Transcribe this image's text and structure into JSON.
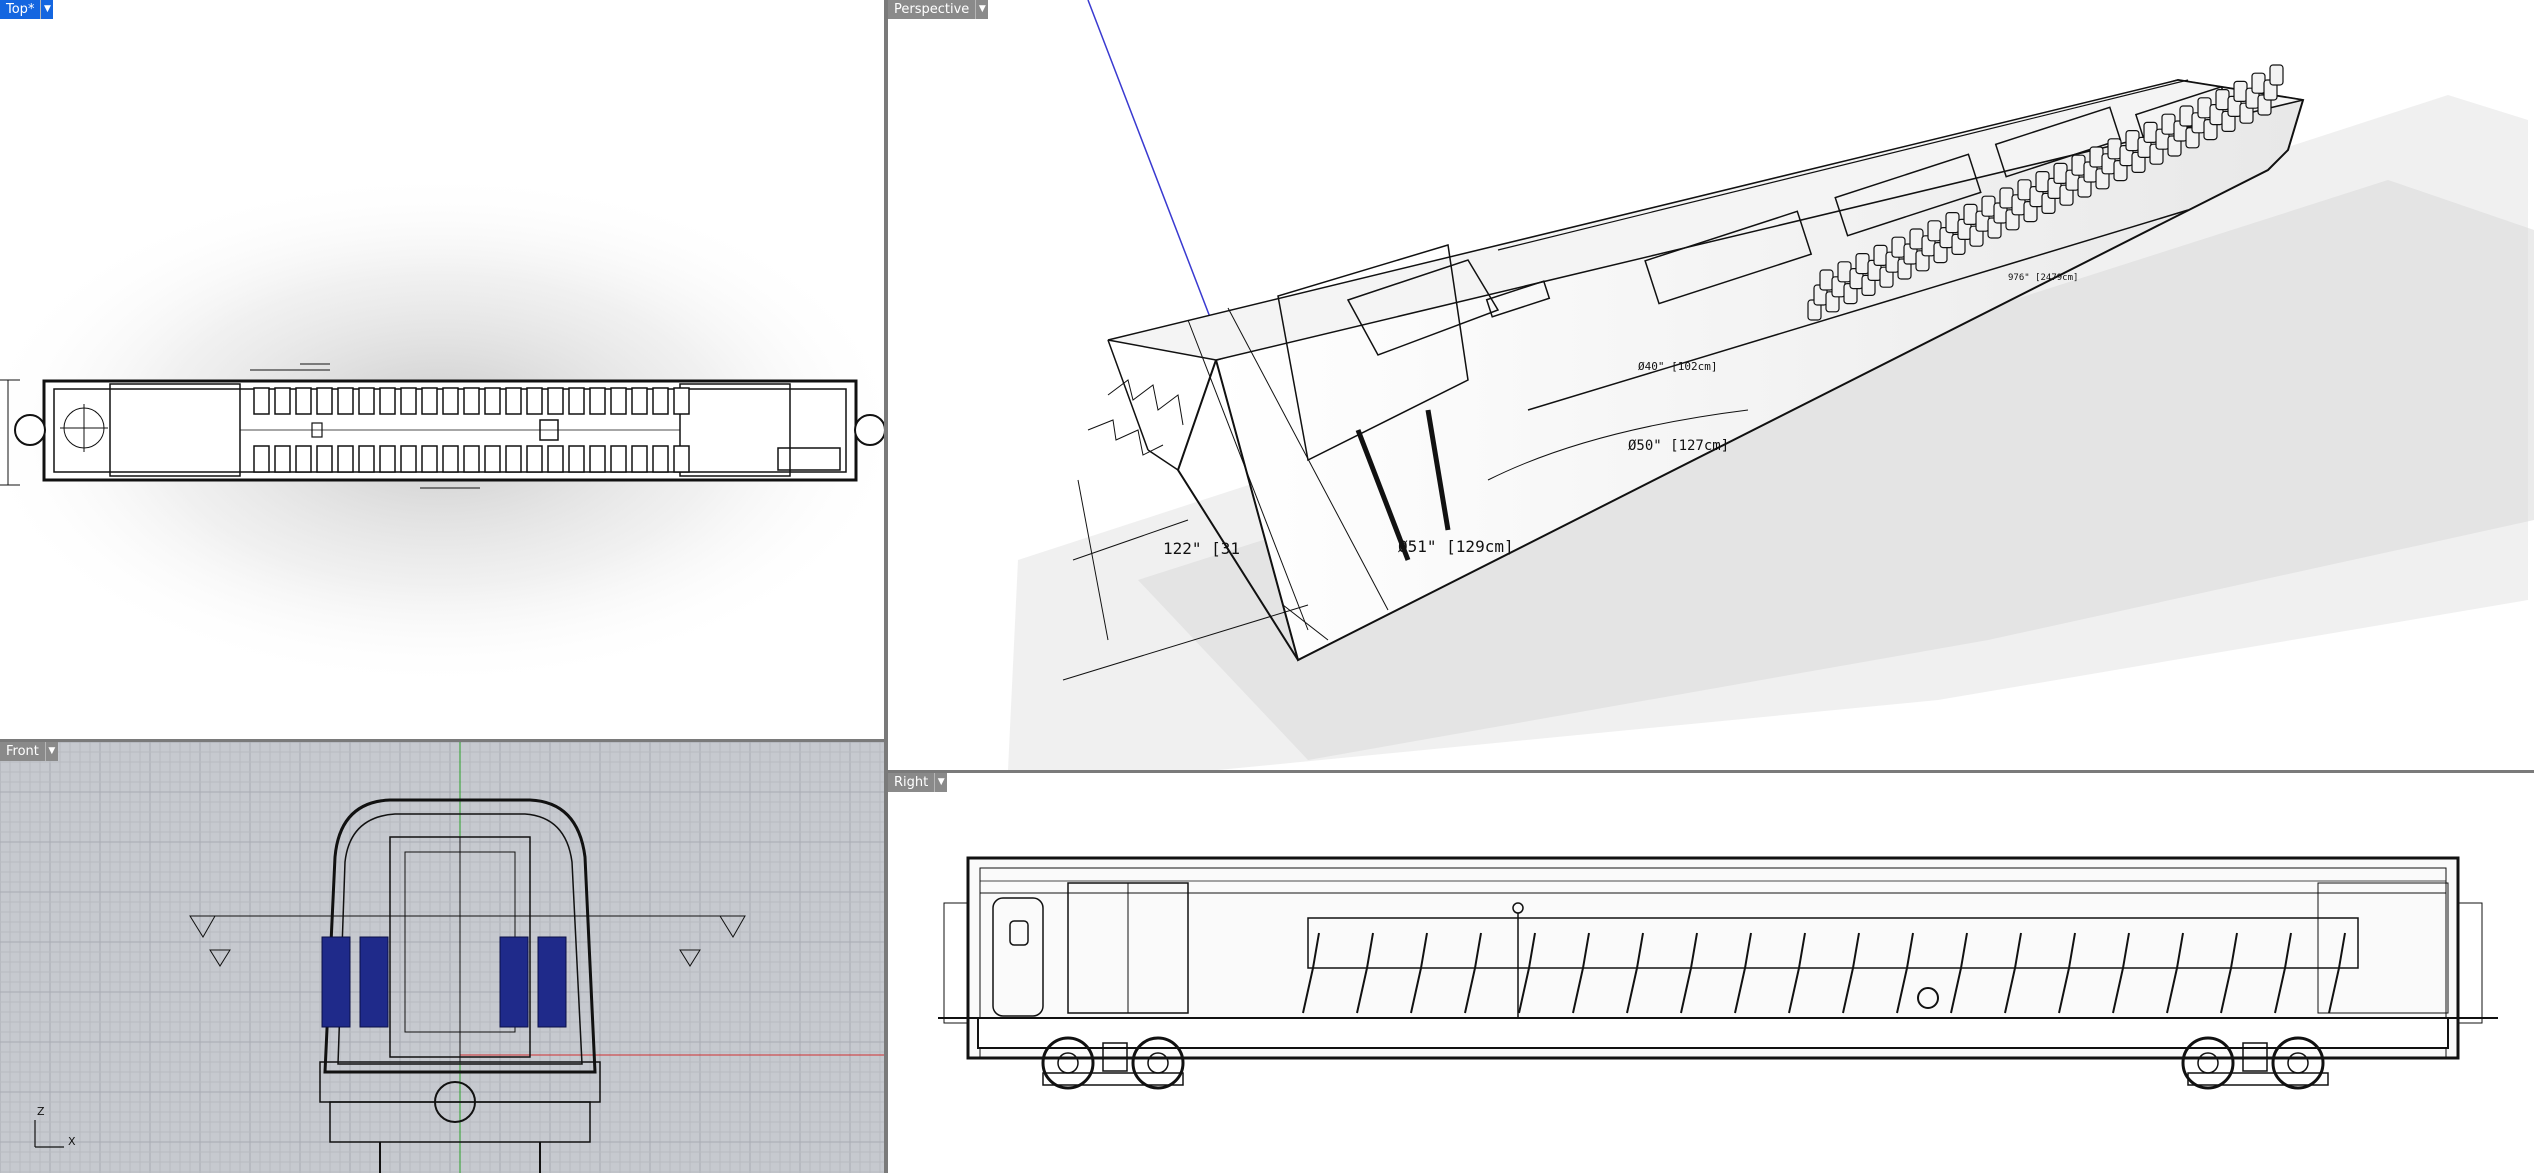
{
  "viewports": {
    "top": {
      "label": "Top*"
    },
    "perspective": {
      "label": "Perspective"
    },
    "front": {
      "label": "Front"
    },
    "right": {
      "label": "Right"
    }
  },
  "dropdown_icon": "chevron-down-icon",
  "dimensions": {
    "perspective_1": "Ø51\" [129cm]",
    "perspective_2": "Ø50\" [127cm]",
    "perspective_3": "Ø40\" [102cm]",
    "perspective_4": "122\" [31",
    "perspective_5": "976\" [2479cm]"
  },
  "axis_labels": {
    "z": "Z",
    "x": "X"
  },
  "colors": {
    "active_tab": "#1466e0",
    "inactive_tab": "#8a8a8a",
    "seat_blue": "#1f2a8a",
    "front_bg": "#c6c9cf"
  }
}
